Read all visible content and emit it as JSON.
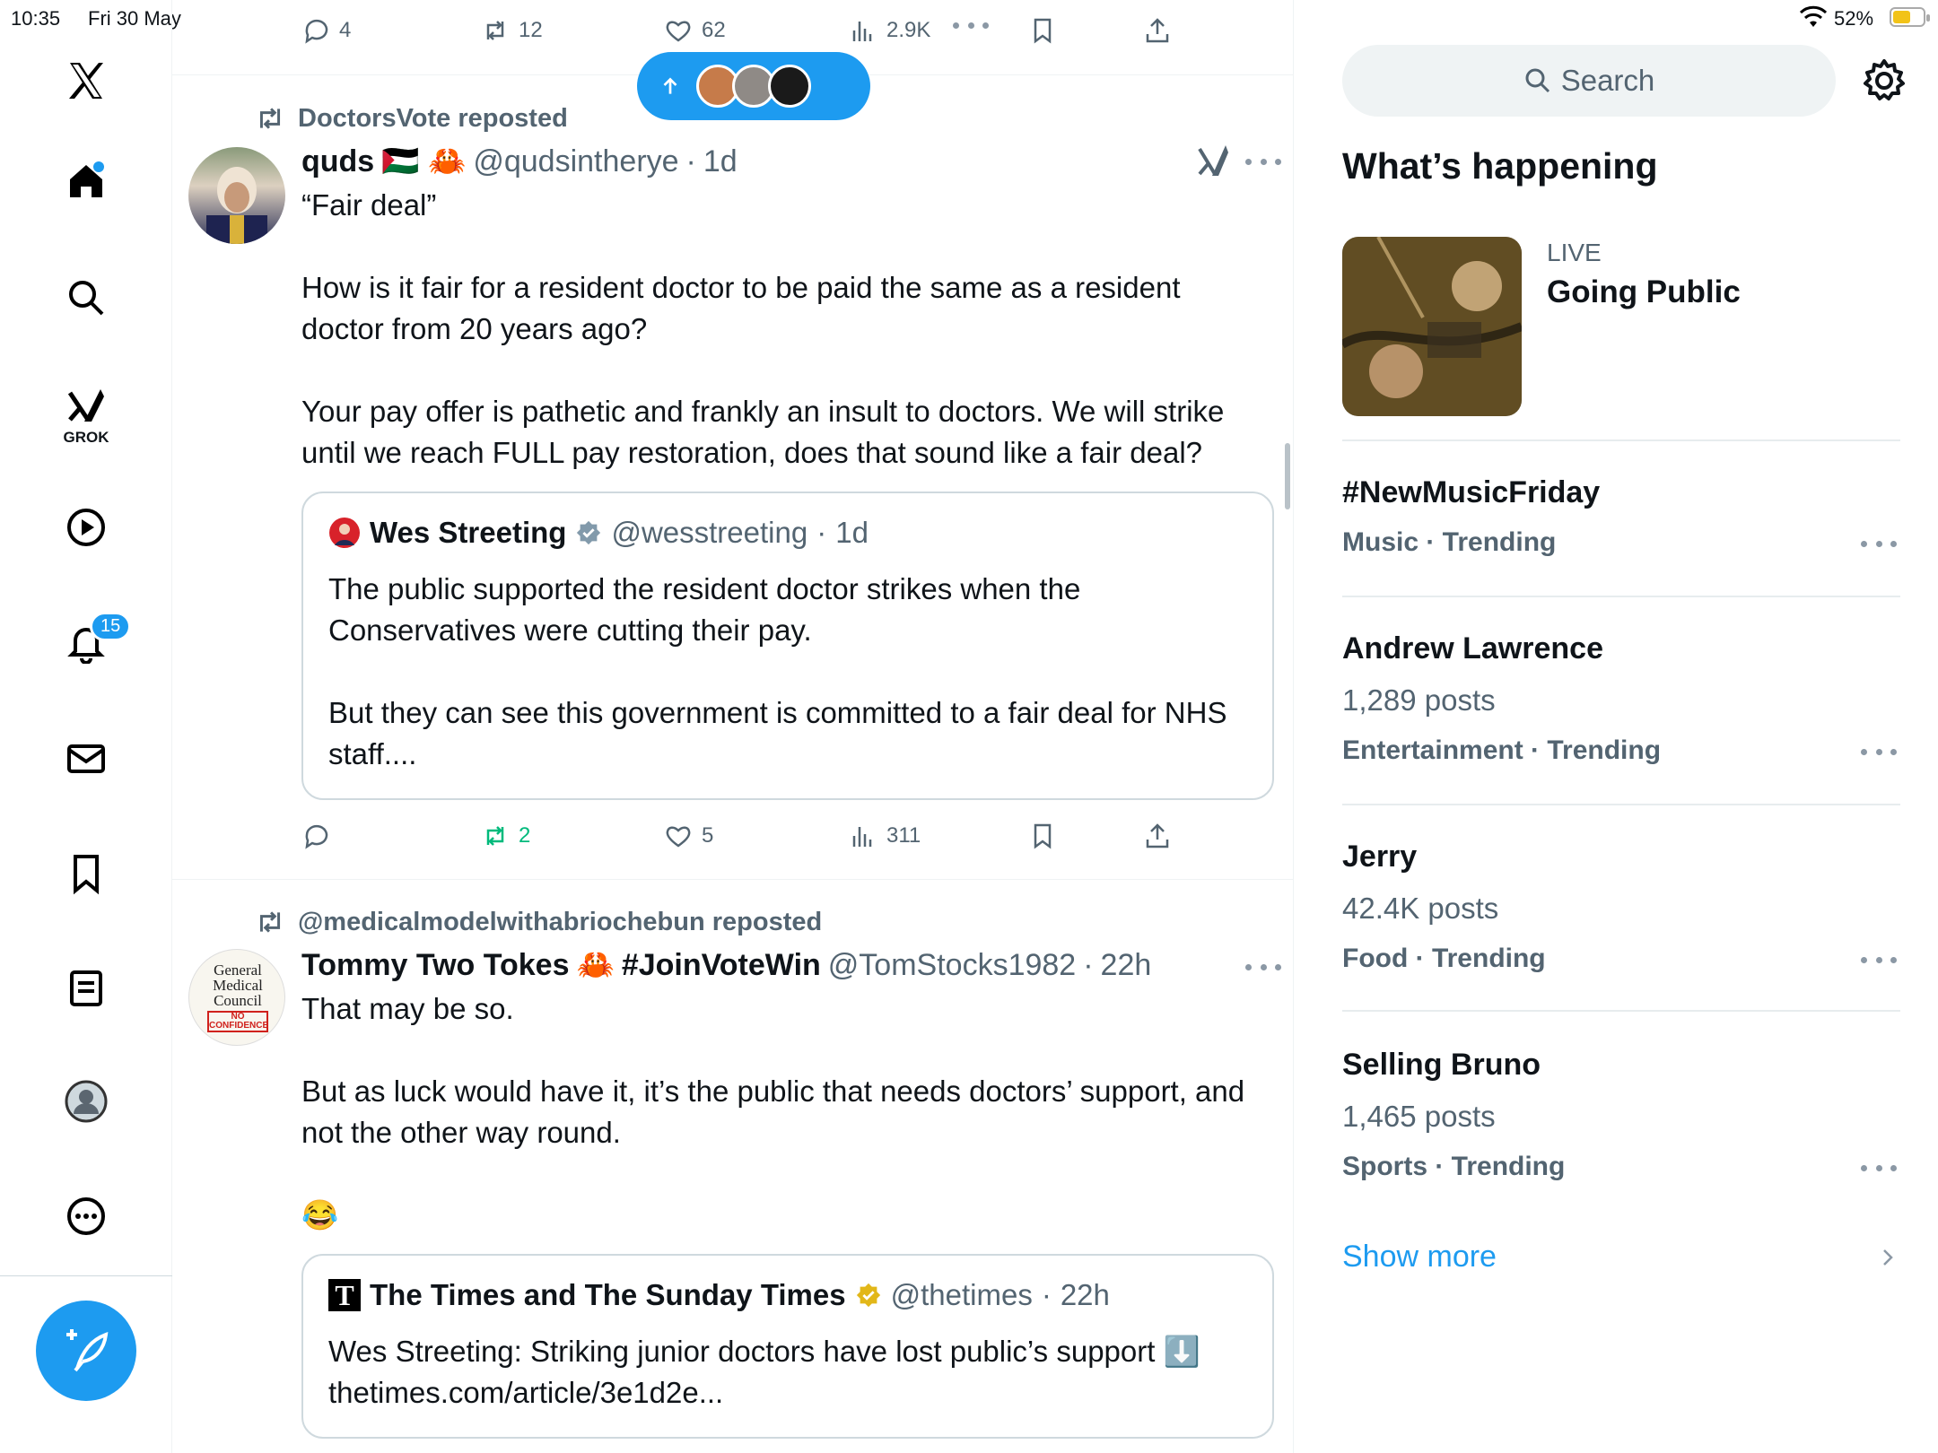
{
  "status_bar": {
    "time": "10:35",
    "date": "Fri 30 May",
    "battery_pct": "52%",
    "battery_level": 0.52
  },
  "nav": {
    "grok_label": "GROK",
    "notifications_badge": "15"
  },
  "top_actions": {
    "replies": "4",
    "reposts": "12",
    "likes": "62",
    "views": "2.9K"
  },
  "tweets": [
    {
      "reposted_by": "DoctorsVote reposted",
      "name": "quds",
      "flags": "🇵🇸 🦀",
      "handle": "@qudsintherye",
      "sep": "·",
      "time": "1d",
      "text": "“Fair deal”\n\nHow is it fair for a resident doctor to be paid the same as a resident doctor from 20 years ago?\n\nYour pay offer is pathetic and frankly an insult to doctors. We will strike until we reach FULL pay restoration, does that sound like a fair deal?",
      "quote": {
        "name": "Wes Streeting",
        "handle": "@wesstreeting",
        "time": "1d",
        "text": "The public supported the resident doctor strikes when the Conservatives were cutting their pay.\n\nBut they can see this government is committed to a fair deal for NHS staff...."
      },
      "actions": {
        "replies": "",
        "reposts": "2",
        "likes": "5",
        "views": "311"
      }
    },
    {
      "reposted_by": "@medicalmodelwithabriochebun reposted",
      "name": "Tommy Two Tokes",
      "crab": "🦀",
      "tag": "#JoinVoteWin",
      "handle": "@TomStocks1982",
      "sep": "·",
      "time": "22h",
      "avatar_text": [
        "General",
        "Medical",
        "Council",
        "NO",
        "CONFIDENCE"
      ],
      "text": "That may be so.\n\nBut as luck would have it, it’s the public that needs doctors’ support, and not the other way round.",
      "emoji": "😂",
      "quote": {
        "logo": "T",
        "name": "The Times and The Sunday Times",
        "handle": "@thetimes",
        "time": "22h",
        "text": "Wes Streeting: Striking junior doctors have lost public’s support ⬇️\nthetimes.com/article/3e1d2e..."
      }
    }
  ],
  "right": {
    "search_placeholder": "Search",
    "section_title": "What’s happening",
    "live": {
      "label": "LIVE",
      "title": "Going Public"
    },
    "trends": [
      {
        "title": "#NewMusicFriday",
        "posts": "",
        "meta": "Music · Trending"
      },
      {
        "title": "Andrew Lawrence",
        "posts": "1,289 posts",
        "meta": "Entertainment · Trending"
      },
      {
        "title": "Jerry",
        "posts": "42.4K posts",
        "meta": "Food · Trending"
      },
      {
        "title": "Selling Bruno",
        "posts": "1,465 posts",
        "meta": "Sports · Trending"
      }
    ],
    "show_more": "Show more"
  },
  "colors": {
    "accent": "#1d9bf0",
    "repost_green": "#00ba7c",
    "muted": "#536471",
    "verified_gold": "#e2b719"
  }
}
